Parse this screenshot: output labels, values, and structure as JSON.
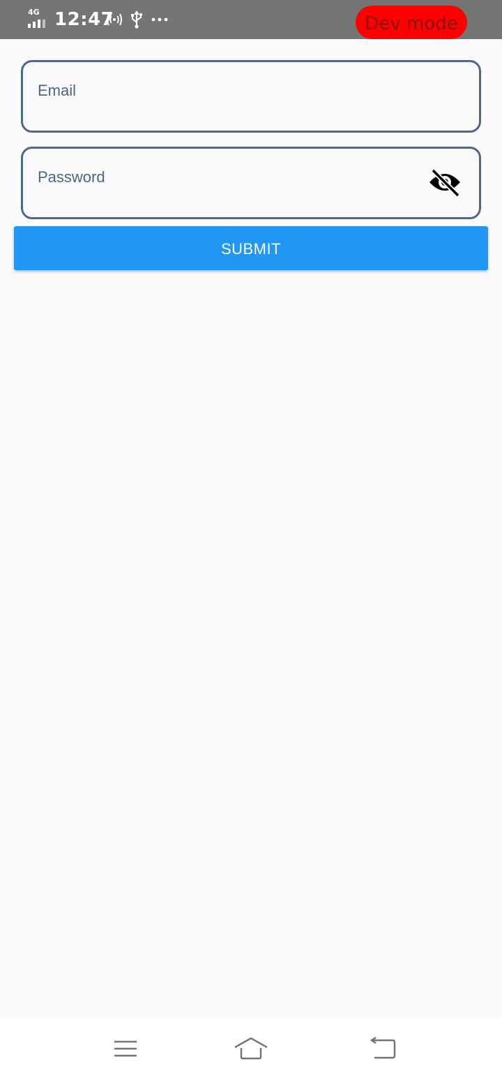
{
  "status_bar": {
    "network": "4G",
    "time": "12:47",
    "icons": [
      "signal-icon",
      "hotspot-icon",
      "usb-icon",
      "more-notifications-icon"
    ],
    "dev_badge": "Dev mode"
  },
  "form": {
    "email": {
      "placeholder": "Email",
      "value": ""
    },
    "password": {
      "placeholder": "Password",
      "value": "",
      "toggle_icon": "visibility-off-icon"
    },
    "submit_label": "SUBMIT"
  },
  "nav_bar": {
    "icons": [
      "menu-icon",
      "home-icon",
      "back-icon"
    ]
  },
  "colors": {
    "status_bar": "#757575",
    "dev_badge": "#ff0000",
    "field_border": "#4f6589",
    "button": "#2196f3",
    "background": "#fafafa"
  }
}
